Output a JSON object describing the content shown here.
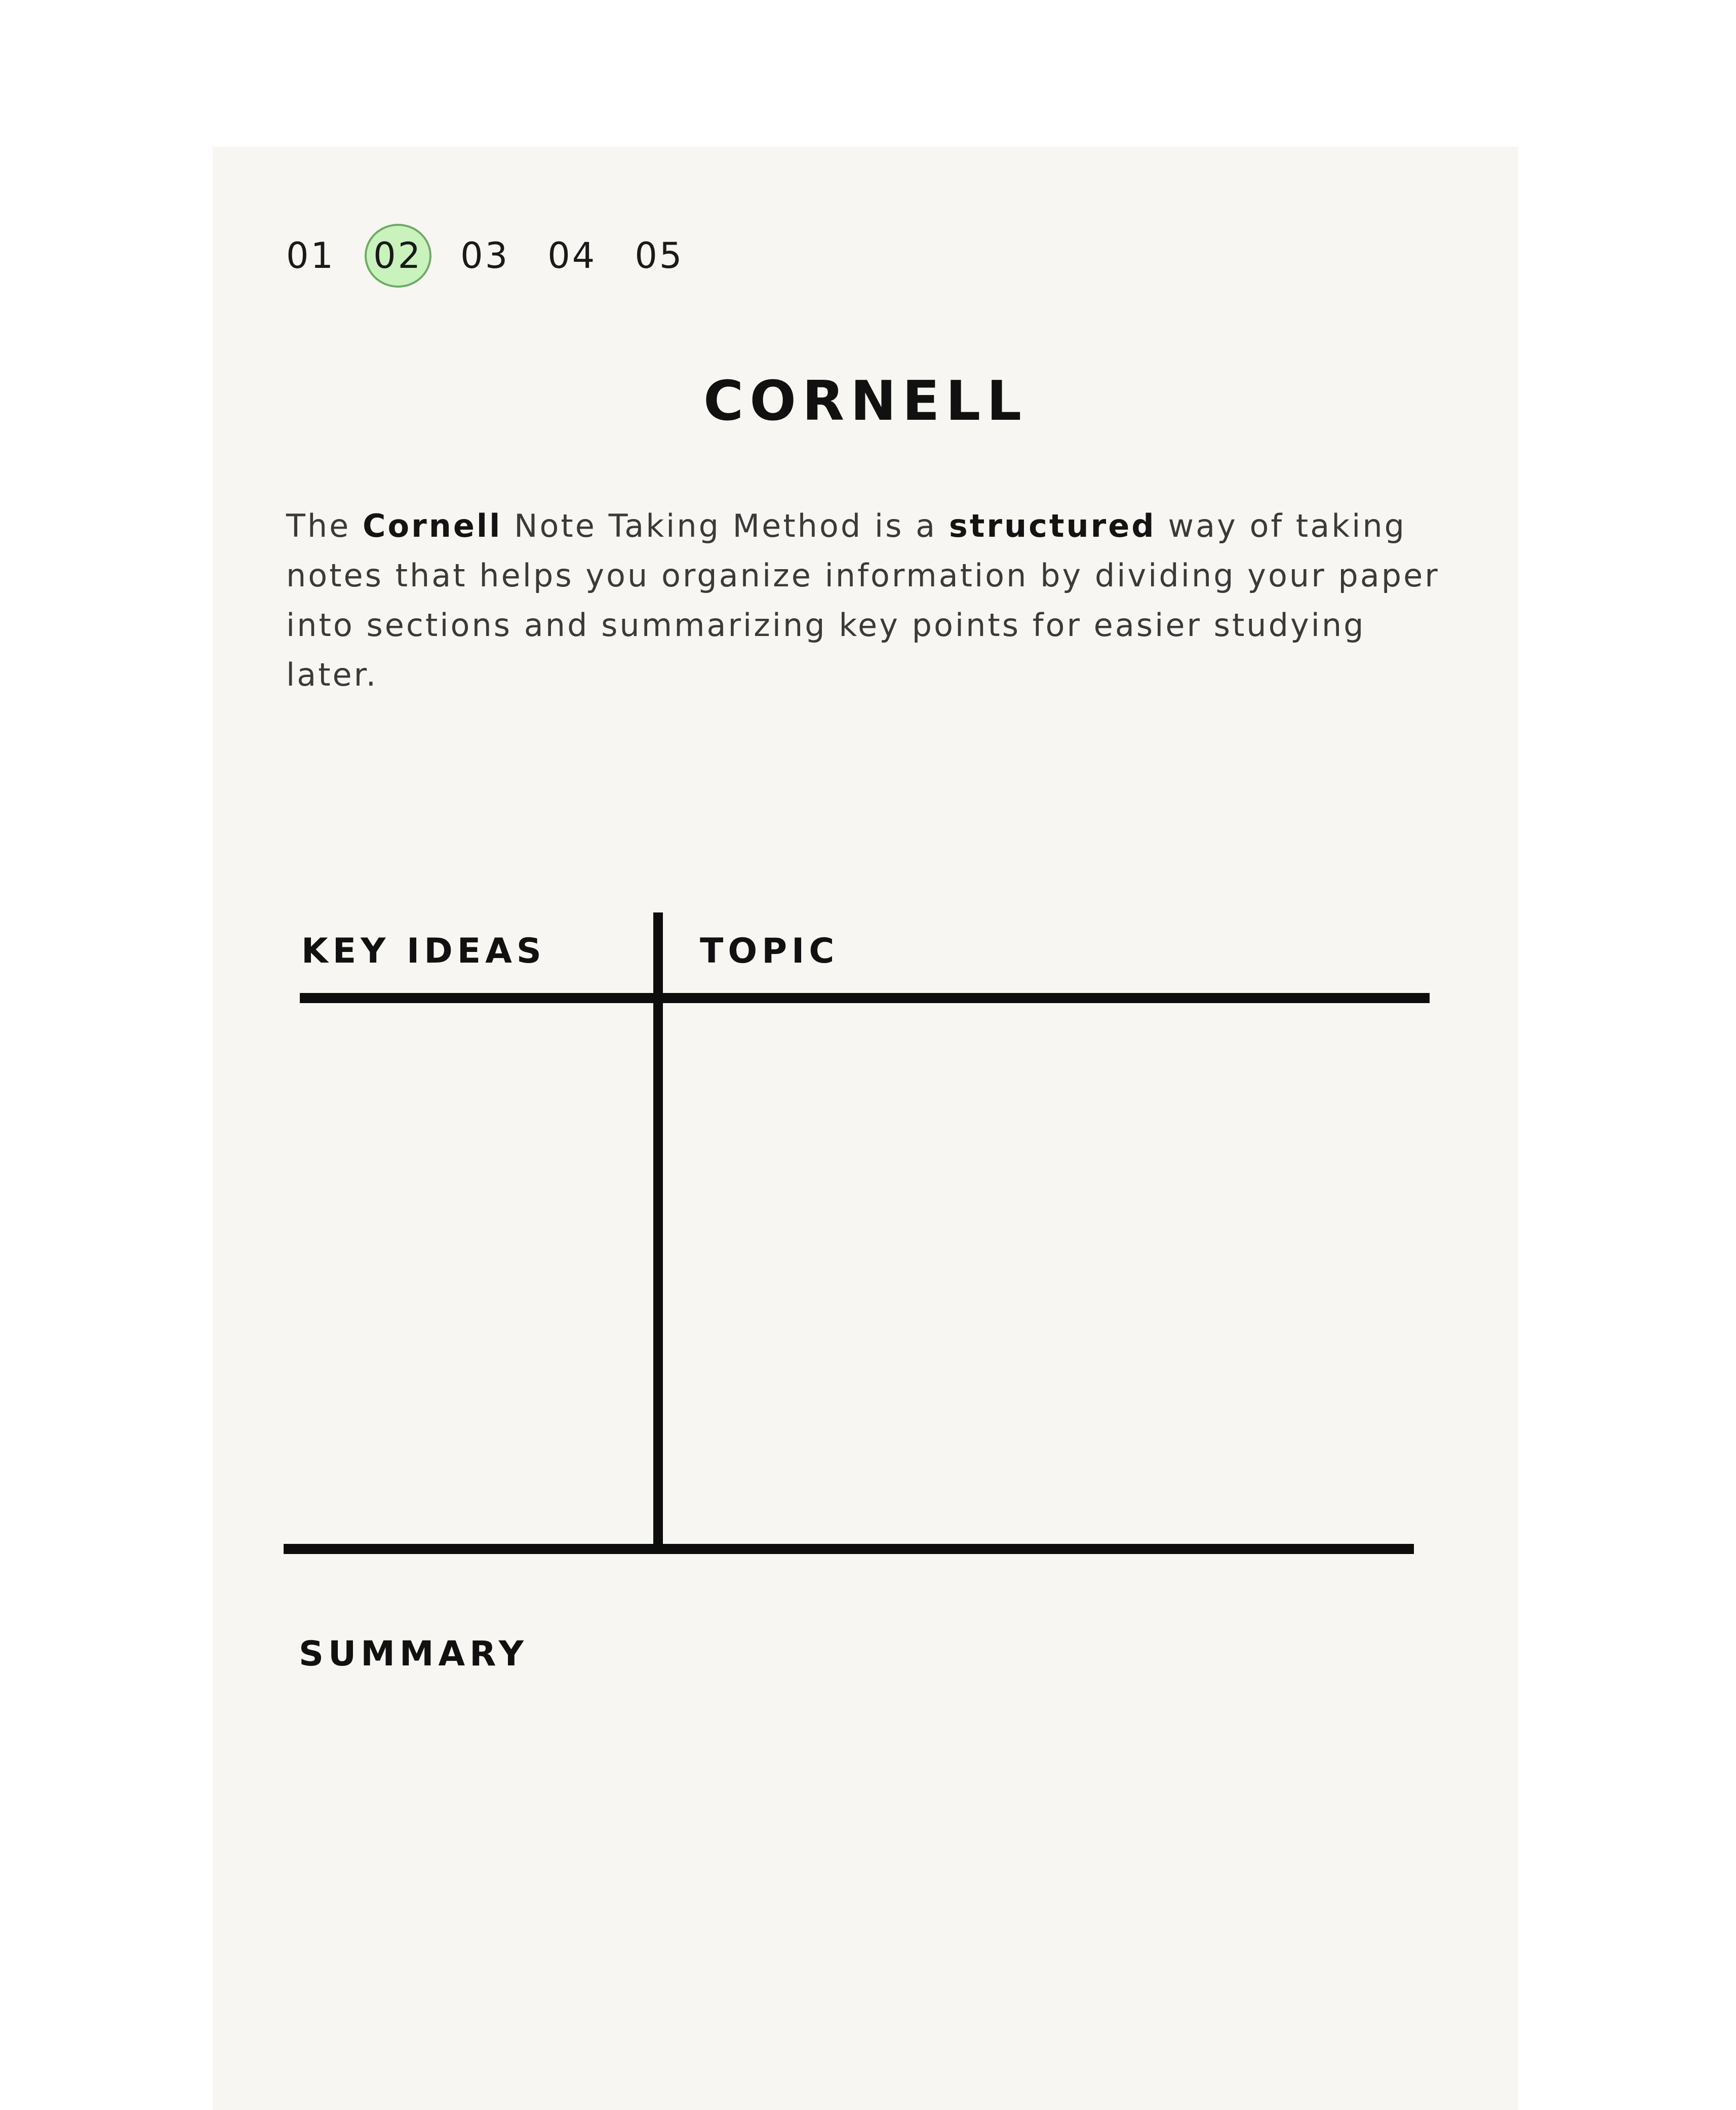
{
  "pagination": {
    "pages": [
      "01",
      "02",
      "03",
      "04",
      "05"
    ],
    "active": "02"
  },
  "title": "CORNELL",
  "description": {
    "t1": "The ",
    "b1": "Cornell",
    "t2": " Note Taking Method is a ",
    "b2": "structured",
    "t3": " way of taking notes that helps you organize information by dividing your paper into sections and summarizing key points for easier studying later."
  },
  "template": {
    "key_ideas_label": "KEY IDEAS",
    "topic_label": "TOPIC",
    "summary_label": "SUMMARY"
  },
  "colors": {
    "card_background": "#f7f6f2",
    "active_highlight": "#c9f2bd",
    "ink": "#111111"
  }
}
